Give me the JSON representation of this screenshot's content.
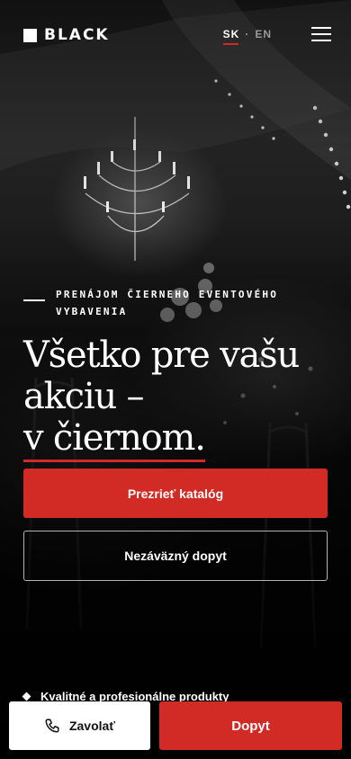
{
  "header": {
    "logo_text": "BLACK",
    "lang_active": "SK",
    "lang_separator": "·",
    "lang_other": "EN",
    "menu_icon": "hamburger-icon"
  },
  "hero": {
    "eyebrow_line1": "PRENÁJOM ČIERNEHO EVENTOVÉHO",
    "eyebrow_line2": "VYBAVENIA",
    "headline_line1": "Všetko pre vašu",
    "headline_line2": "akciu –",
    "headline_line3": "v čiernom."
  },
  "cta": {
    "primary_label": "Prezrieť katalóg",
    "secondary_label": "Nezáväzný dopyt"
  },
  "features": [
    "Kvalitné a profesionálne produkty"
  ],
  "bottom_bar": {
    "call_label": "Zavolať",
    "call_icon": "phone-icon",
    "quote_label": "Dopyt"
  },
  "colors": {
    "accent": "#d22b26",
    "background": "#000000",
    "text": "#ffffff"
  }
}
